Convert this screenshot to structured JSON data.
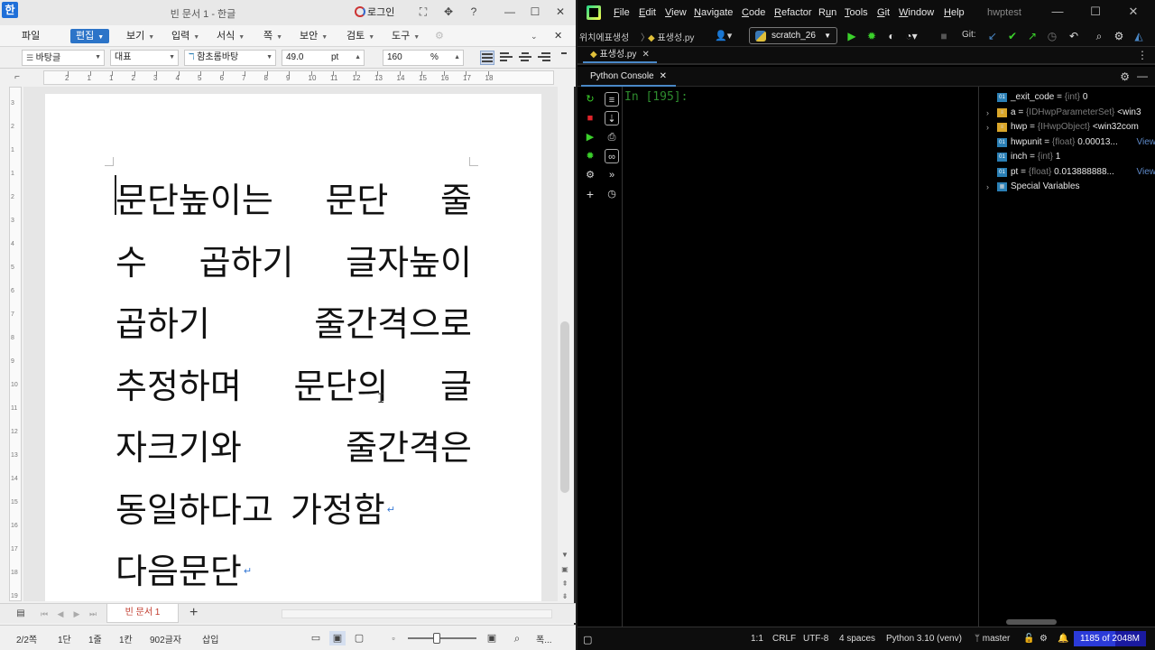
{
  "hwp": {
    "logo": "한",
    "title": "빈 문서 1 - 한글",
    "login": "로그인",
    "menu": [
      {
        "label": "파일",
        "caret": false
      },
      {
        "label": "편집",
        "caret": true,
        "active": true
      },
      {
        "label": "보기",
        "caret": true
      },
      {
        "label": "입력",
        "caret": true
      },
      {
        "label": "서식",
        "caret": true
      },
      {
        "label": "쪽",
        "caret": true
      },
      {
        "label": "보안",
        "caret": true
      },
      {
        "label": "검토",
        "caret": true
      },
      {
        "label": "도구",
        "caret": true
      }
    ],
    "format": {
      "style": "바탕글",
      "language": "대표",
      "font": "함초롬바탕",
      "size": "49.0",
      "size_unit": "pt",
      "line_spacing": "160",
      "line_spacing_unit": "%"
    },
    "ruler_numbers": [
      "2",
      "1",
      "1",
      "2",
      "3",
      "4",
      "5",
      "6",
      "7",
      "8",
      "9",
      "10",
      "11",
      "12",
      "13",
      "14",
      "15",
      "16",
      "17",
      "18"
    ],
    "vruler_numbers": [
      "3",
      "2",
      "1",
      "1",
      "2",
      "3",
      "4",
      "5",
      "6",
      "7",
      "8",
      "9",
      "10",
      "11",
      "12",
      "13",
      "14",
      "15",
      "16",
      "17",
      "18",
      "19"
    ],
    "document_lines": [
      [
        "문단높이는",
        "문단",
        "줄"
      ],
      [
        "수",
        "곱하기",
        "글자높이"
      ],
      [
        "곱하기",
        "줄간격으로"
      ],
      [
        "추정하며",
        "문단의",
        "글"
      ],
      [
        "자크기와",
        "줄간격은"
      ],
      [
        "동일하다고",
        "가정함"
      ],
      [
        "다음문단"
      ]
    ],
    "paragraph_mark": "↵",
    "doc_tab": "빈 문서 1",
    "add_tab": "+",
    "status": {
      "page": "2/2쪽",
      "section": "1단",
      "line": "1줄",
      "column": "1칸",
      "chars": "902글자",
      "mode": "삽입",
      "zoom_label": "폭..."
    }
  },
  "pycharm": {
    "menu": [
      "File",
      "Edit",
      "View",
      "Navigate",
      "Code",
      "Refactor",
      "Run",
      "Tools",
      "Git",
      "Window",
      "Help"
    ],
    "menu_mnemonics": [
      "F",
      "E",
      "V",
      "N",
      "C",
      "R",
      "u",
      "T",
      "G",
      "W",
      "H"
    ],
    "project": "hwptest",
    "breadcrumb_dir": "위치에표생성",
    "breadcrumb_file": "표생성.py",
    "run_config": "scratch_26",
    "git_label": "Git:",
    "file_tab": "표생성.py",
    "console_tab": "Python Console",
    "prompt": "In [195]:",
    "variables": [
      {
        "expand": "",
        "icon": "01",
        "kind": "int",
        "name": "_exit_code",
        "type": "{int}",
        "value": "0",
        "view": ""
      },
      {
        "expand": "›",
        "icon": "≡",
        "kind": "obj",
        "name": "a",
        "type": "{IDHwpParameterSet}",
        "value": "<win3",
        "view": ""
      },
      {
        "expand": "›",
        "icon": "≡",
        "kind": "obj",
        "name": "hwp",
        "type": "{IHwpObject}",
        "value": "<win32com",
        "view": ""
      },
      {
        "expand": "",
        "icon": "01",
        "kind": "int",
        "name": "hwpunit",
        "type": "{float}",
        "value": "0.00013...",
        "view": "View"
      },
      {
        "expand": "",
        "icon": "01",
        "kind": "int",
        "name": "inch",
        "type": "{int}",
        "value": "1",
        "view": ""
      },
      {
        "expand": "",
        "icon": "01",
        "kind": "int",
        "name": "pt",
        "type": "{float}",
        "value": "0.013888888...",
        "view": "View"
      },
      {
        "expand": "›",
        "icon": "▦",
        "kind": "spec",
        "name": "Special Variables",
        "type": "",
        "value": "",
        "view": ""
      }
    ],
    "status": {
      "position": "1:1",
      "line_sep": "CRLF",
      "encoding": "UTF-8",
      "indent": "4 spaces",
      "interpreter": "Python 3.10 (venv)",
      "branch": "master",
      "memory": "1185 of 2048M",
      "memory_used_fraction": 0.58
    },
    "colors": {
      "accent": "#4a88c7",
      "run": "#3bd12b",
      "stop": "#e0242b",
      "prompt": "#2e8b2e"
    }
  }
}
